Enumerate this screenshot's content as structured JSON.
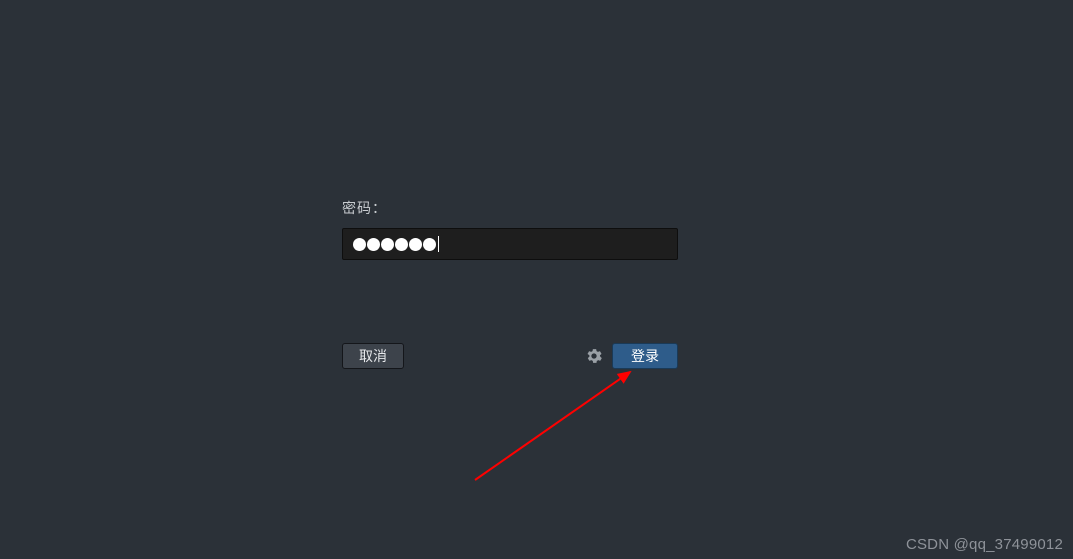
{
  "login": {
    "password_label": "密码：",
    "password_value_masked_length": 6,
    "cancel_label": "取消",
    "login_label": "登录"
  },
  "icons": {
    "settings": "gear-icon"
  },
  "annotation": {
    "arrow_color": "#ff0000"
  },
  "watermark": "CSDN @qq_37499012"
}
